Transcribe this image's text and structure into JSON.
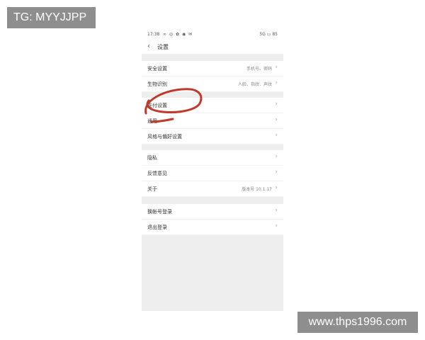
{
  "watermarks": {
    "top": "TG: MYYJJPP",
    "bottom": "www.thps1996.com"
  },
  "status_bar": {
    "time": "17:38",
    "icons": "∞ ◎ ✿ ◉ ✉",
    "right": "5G ▭ 85"
  },
  "header": {
    "back_icon": "‹",
    "title": "设置"
  },
  "groups": [
    {
      "rows": [
        {
          "label": "安全设置",
          "value": "手机号、密码"
        },
        {
          "label": "生物识别",
          "value": "人脸、指纹、声纹"
        }
      ]
    },
    {
      "rows": [
        {
          "label": "支付设置",
          "value": ""
        },
        {
          "label": "通用",
          "value": ""
        },
        {
          "label": "风格与偏好设置",
          "value": ""
        }
      ]
    },
    {
      "rows": [
        {
          "label": "隐私",
          "value": ""
        },
        {
          "label": "反馈意见",
          "value": ""
        },
        {
          "label": "关于",
          "value": "版本号 10.1.17"
        }
      ]
    },
    {
      "rows": [
        {
          "label": "换帐号登录",
          "value": ""
        },
        {
          "label": "退出登录",
          "value": ""
        }
      ]
    }
  ],
  "chevron": "›",
  "colors": {
    "annotation": "#c0392b",
    "watermark_bg": "#8e8e8e"
  }
}
